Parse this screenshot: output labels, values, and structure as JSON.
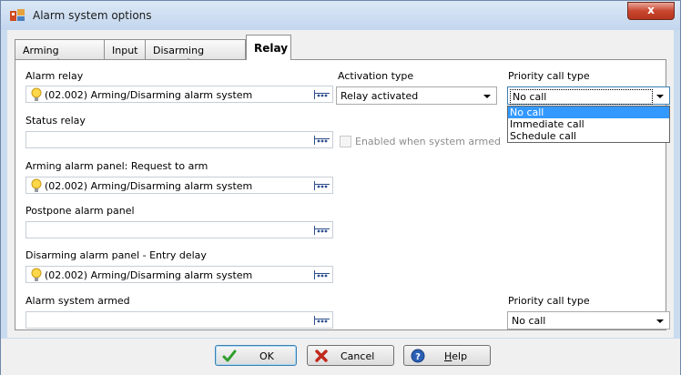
{
  "window": {
    "title": "Alarm system options",
    "close_label": "x"
  },
  "tabs": [
    {
      "label": "Arming request"
    },
    {
      "label": "Input"
    },
    {
      "label": "Disarming request"
    },
    {
      "label": "Relay"
    }
  ],
  "active_tab": "Relay",
  "left_fields": [
    {
      "label": "Alarm relay",
      "value": "(02.002) Arming/Disarming alarm system",
      "has_icon": true
    },
    {
      "label": "Status relay",
      "value": "",
      "has_icon": false
    },
    {
      "label": "Arming alarm panel: Request to arm",
      "value": "(02.002) Arming/Disarming alarm system",
      "has_icon": true
    },
    {
      "label": "Postpone alarm panel",
      "value": "",
      "has_icon": false
    },
    {
      "label": "Disarming alarm panel - Entry delay",
      "value": "(02.002) Arming/Disarming alarm system",
      "has_icon": true
    },
    {
      "label": "Alarm system armed",
      "value": "",
      "has_icon": false
    }
  ],
  "activation": {
    "label": "Activation type",
    "value": "Relay activated"
  },
  "enabled_checkbox": {
    "label": "Enabled when system armed",
    "checked": false,
    "enabled": false
  },
  "priority_top": {
    "label": "Priority call type",
    "value": "No call",
    "options": [
      "No call",
      "Immediate call",
      "Schedule call"
    ],
    "highlighted": "No call"
  },
  "priority_bottom": {
    "label": "Priority call type",
    "value": "No call"
  },
  "buttons": {
    "ok": "OK",
    "cancel": "Cancel",
    "help_prefix": "",
    "help_mnemonic": "H",
    "help_rest": "elp"
  },
  "colors": {
    "selection": "#3399ff",
    "focus_border": "#3c7fb1",
    "ok_check": "#2e9e2e",
    "cancel_x": "#c0281c",
    "help_blue": "#2a5fb4"
  },
  "icons": {
    "app": "alarm-app-icon",
    "field_value": "lightbulb-icon",
    "browse": "browse-ellipsis-icon",
    "ok": "checkmark-icon",
    "cancel": "red-x-icon",
    "help": "help-question-icon"
  }
}
